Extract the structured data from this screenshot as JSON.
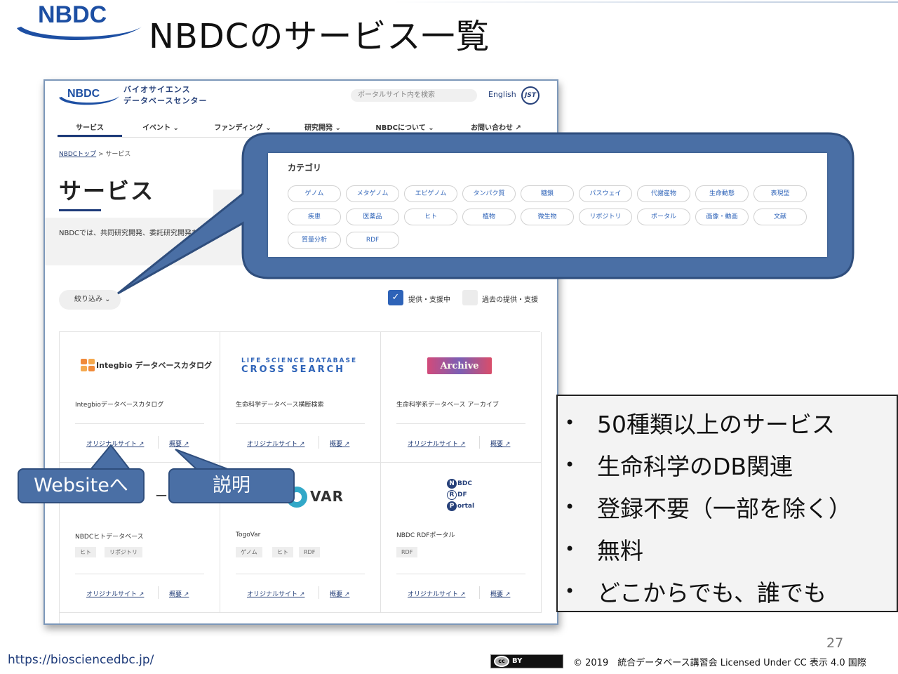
{
  "slide": {
    "title": "NBDCのサービス一覧",
    "logo_text": "NBDC",
    "page_number": "27",
    "url": "https://biosciencedbc.jp/",
    "copyright": "© 2019　統合データベース講習会 Licensed Under CC 表示 4.0 国際",
    "cc_mark": "cc",
    "cc_by": "BY"
  },
  "site": {
    "logo_text": "NBDC",
    "name": "バイオサイエンス\nデータベースセンター",
    "search_placeholder": "ポータルサイト内を検索",
    "english_link": "English",
    "jst_badge": "JST",
    "nav": [
      {
        "label": "サービス"
      },
      {
        "label": "イベント ⌄"
      },
      {
        "label": "ファンディング ⌄"
      },
      {
        "label": "研究開発 ⌄"
      },
      {
        "label": "NBDCについて ⌄"
      },
      {
        "label": "お問い合わせ ↗"
      }
    ],
    "breadcrumb": {
      "home": "NBDCトップ",
      "separator": " > ",
      "current": "サービス"
    },
    "heading": "サービス",
    "description": "NBDCでは、共同研究開発、委託研究開発などを通",
    "filter_label": "絞り込み ⌄",
    "check_on_label": "提供・支援中",
    "check_off_label": "過去の提供・支援",
    "check_mark": "✓"
  },
  "categories": {
    "heading": "カテゴリ",
    "chips": [
      "ゲノム",
      "メタゲノム",
      "エピゲノム",
      "タンパク質",
      "糖鎖",
      "パスウェイ",
      "代謝産物",
      "生命動態",
      "表現型",
      "疾患",
      "医薬品",
      "ヒト",
      "植物",
      "微生物",
      "リポジトリ",
      "ポータル",
      "画像・動画",
      "文献",
      "質量分析",
      "RDF"
    ]
  },
  "cards": [
    {
      "logo": "Integbio データベースカタログ",
      "title": "Integbioデータベースカタログ",
      "link1": "オリジナルサイト ↗",
      "link2": "概要 ↗",
      "tags": []
    },
    {
      "logo_line1": "LIFE SCIENCE DATABASE",
      "logo_line2": "CROSS SEARCH",
      "title": "生命科学データベース横断検索",
      "link1": "オリジナルサイト ↗",
      "link2": "概要 ↗",
      "tags": []
    },
    {
      "logo": "Archive",
      "title": "生命科学系データベース アーカイブ",
      "link1": "オリジナルサイト ↗",
      "link2": "概要 ↗",
      "tags": []
    },
    {
      "logo_partial": "ータ",
      "title": "NBDCヒトデータベース",
      "link1": "オリジナルサイト ↗",
      "link2": "概要 ↗",
      "tags": [
        "ヒト",
        "リポジトリ"
      ]
    },
    {
      "logo": "VAR",
      "title": "TogoVar",
      "link1": "オリジナルサイト ↗",
      "link2": "概要 ↗",
      "tags": [
        "ゲノム",
        "ヒト",
        "RDF"
      ]
    },
    {
      "logo_letters": [
        [
          "N",
          "BDC"
        ],
        [
          "R",
          "DF"
        ],
        [
          "P",
          "ortal"
        ]
      ],
      "title": "NBDC RDFポータル",
      "link1": "オリジナルサイト ↗",
      "link2": "概要 ↗",
      "tags": [
        "RDF"
      ]
    }
  ],
  "labels": {
    "website": "Websiteへ",
    "description": "説明"
  },
  "bullets": {
    "marker": "•",
    "items": [
      "50種類以上のサービス",
      "生命科学のDB関連",
      "登録不要（一部を除く）",
      "無料",
      "どこからでも、誰でも"
    ]
  },
  "colors": {
    "nbdc_blue": "#1d3a79",
    "callout_blue": "#4a6fa5",
    "link_blue": "#2e63b8"
  }
}
